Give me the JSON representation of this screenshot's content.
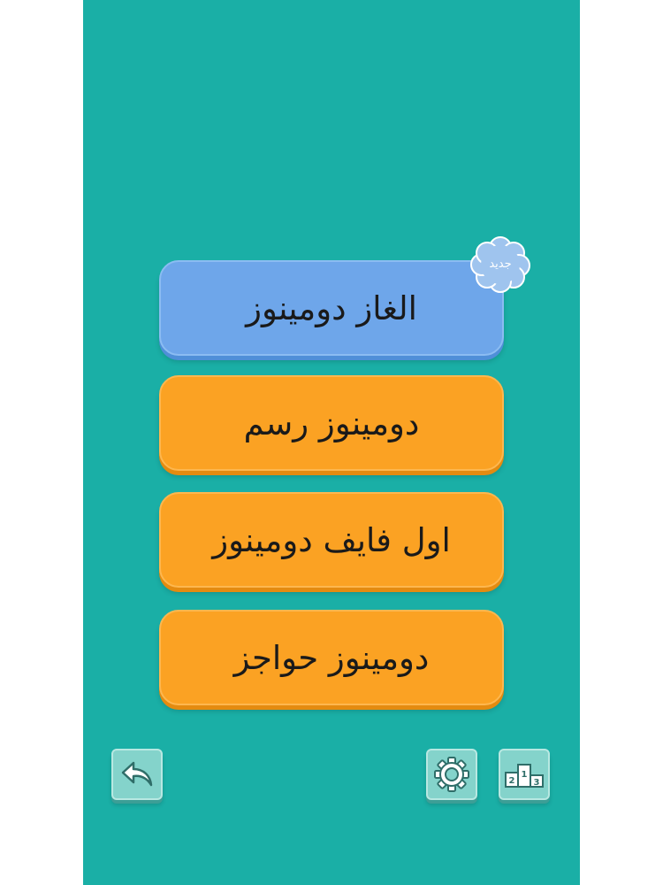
{
  "menu": {
    "items": [
      {
        "label": "الغاز دومينوز",
        "color": "#6ea6ea"
      },
      {
        "label": "دومينوز رسم",
        "color": "#fba223"
      },
      {
        "label": "اول فايف دومينوز",
        "color": "#fba223"
      },
      {
        "label": "دومينوز حواجز",
        "color": "#fba223"
      }
    ],
    "new_badge": "جديد"
  },
  "toolbar": {
    "back_icon": "back-arrow-icon",
    "settings_icon": "gear-icon",
    "leaderboard_icon": "podium-icon",
    "podium_ranks": [
      "2",
      "1",
      "3"
    ]
  },
  "colors": {
    "background": "#1aafa6",
    "accent_blue": "#6ea6ea",
    "accent_orange": "#fba223"
  }
}
